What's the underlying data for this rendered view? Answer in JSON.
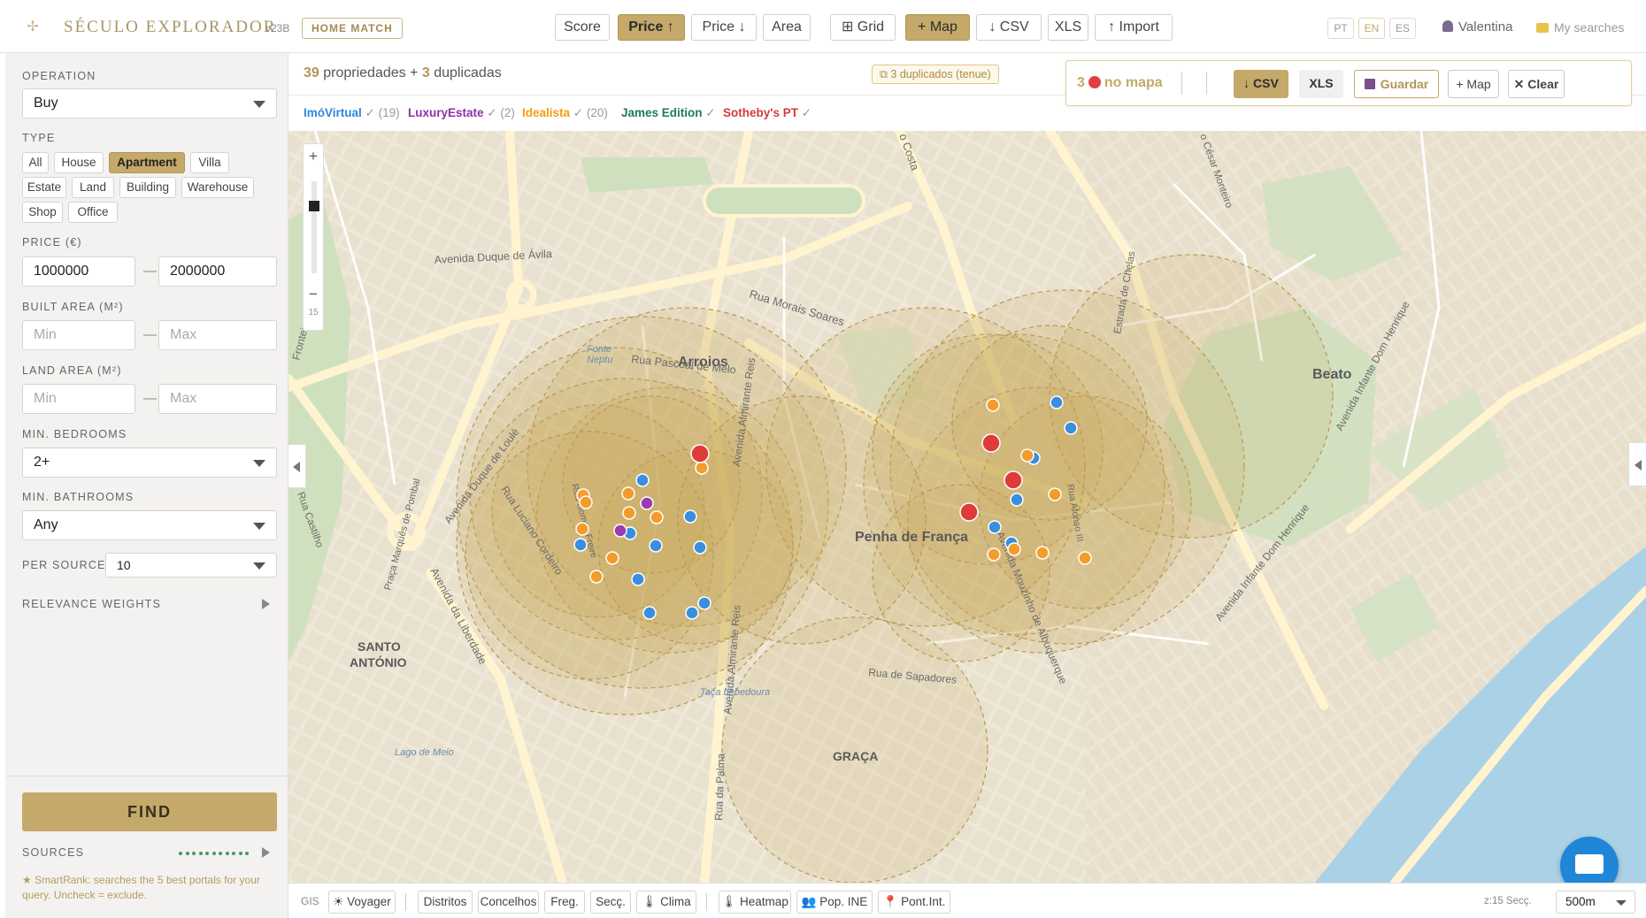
{
  "header": {
    "logo_symbol": "✢",
    "brand": "SÉCULO EXPLORADOR",
    "version": "v23B",
    "home_match": "HOME MATCH",
    "buttons": {
      "score": "Score",
      "price_up": "Price ↑",
      "price_down": "Price ↓",
      "area": "Area",
      "grid": "⊞ Grid",
      "map": "+ Map",
      "csv": "↓ CSV",
      "xls": "XLS",
      "import": "↑ Import"
    },
    "langs": [
      "PT",
      "EN",
      "ES"
    ],
    "active_lang": "EN",
    "user": "Valentina",
    "my_searches": "My searches"
  },
  "sidebar": {
    "operation_label": "OPERATION",
    "operation_value": "Buy",
    "type_label": "TYPE",
    "types": [
      "All",
      "House",
      "Apartment",
      "Villa",
      "Estate",
      "Land",
      "Building",
      "Warehouse",
      "Shop",
      "Office"
    ],
    "active_type": "Apartment",
    "price_label": "PRICE (€)",
    "price_min": "1000000",
    "price_max": "2000000",
    "built_label": "BUILT AREA (M²)",
    "land_label": "LAND AREA (M²)",
    "min_placeholder": "Min",
    "max_placeholder": "Max",
    "dash": "—",
    "bedrooms_label": "MIN. BEDROOMS",
    "bedrooms_value": "2+",
    "bathrooms_label": "MIN. BATHROOMS",
    "bathrooms_value": "Any",
    "per_source_label": "PER SOURCE",
    "per_source_value": "10",
    "weights_label": "RELEVANCE WEIGHTS",
    "find": "FIND",
    "sources_label": "SOURCES",
    "smartrank": "★ SmartRank: searches the 5 best portals for your query. Uncheck = exclude."
  },
  "results": {
    "count": "39",
    "count_text": " propriedades + ",
    "dups": "3",
    "dups_text": " duplicadas",
    "dup_badge": "⧉ 3 duplicados (tenue)"
  },
  "sources": [
    {
      "name": "ImóVirtual",
      "check": " ✓ (19)",
      "color": "#2e86de"
    },
    {
      "name": "LuxuryEstate",
      "check": " ✓ (2)",
      "color": "#8e2fa8"
    },
    {
      "name": "Idealista",
      "check": " ✓ (20)",
      "color": "#f39c12"
    },
    {
      "name": "James Edition",
      "check": " ✓",
      "color": "#1e7a63"
    },
    {
      "name": "Sotheby's PT",
      "check": " ✓",
      "color": "#d33b3b"
    }
  ],
  "floatbar": {
    "count": "3",
    "on_map": "no mapa",
    "csv": "↓ CSV",
    "xls": "XLS",
    "save": "Guardar",
    "map": "+ Map",
    "clear": "✕ Clear"
  },
  "map": {
    "zoom_plus": "+",
    "zoom_minus": "−",
    "zoom_level": "15",
    "labels": {
      "arroios": "Arroios",
      "penha": "Penha de França",
      "beato": "Beato",
      "santo": "SANTO",
      "antonio": "ANTÓNIO",
      "graca": "GRAÇA",
      "duque_avila": "Avenida Duque de Ávila",
      "morais_soares": "Rua Morais Soares",
      "pascoal_melo": "Rua Pascoal de Melo",
      "fonte_neptuno": "Fonte",
      "neptuno": "Neptu",
      "duque_loule": "Avenida Duque de Loulé",
      "luciano_cordeiro": "Rua Luciano Cordeiro",
      "liberdade": "Avenida da Liberdade",
      "castilho": "Rua Castilho",
      "marques": "Praça Marquês de Pombal",
      "almirante_reis": "Avenida Almirante Reis",
      "almirante_reis2": "Avenida Almirante Reis",
      "sapadores": "Rua de Sapadores",
      "taca": "Taça bebedoura",
      "lago": "Lago de Meio",
      "palma": "Rua da Palma",
      "mouzinho": "Avenida Mouzinho de Albuquerque",
      "costa": "o Costa",
      "cesar": "o César Monteiro",
      "chelas": "Estrada de Chelas",
      "infante": "Avenida Infante Dom Henrique",
      "infante2": "Avenida Infante Dom Henrique",
      "fronteira": "Fronteira",
      "afonso": "Rua Afonso III",
      "fontes_pereira": "Rua Gomes Freire"
    }
  },
  "markers": {
    "colors": {
      "imovirtual": "#3a8ee0",
      "idealista": "#f39c2a",
      "luxury": "#9b3bb0",
      "sothebys": "#e03a3a"
    }
  },
  "bottombar": {
    "gis": "GIS",
    "voyager": "☀ Voyager",
    "distritos": "Distritos",
    "concelhos": "Concelhos",
    "freg": "Freg.",
    "secc": "Secç.",
    "clima": "🌡 Clima",
    "heatmap": "🌡 Heatmap",
    "pop_ine": "👥 Pop. INE",
    "pont_int": "📍 Pont.Int.",
    "zinfo": "z:15 Secç.",
    "scale": "500m"
  }
}
